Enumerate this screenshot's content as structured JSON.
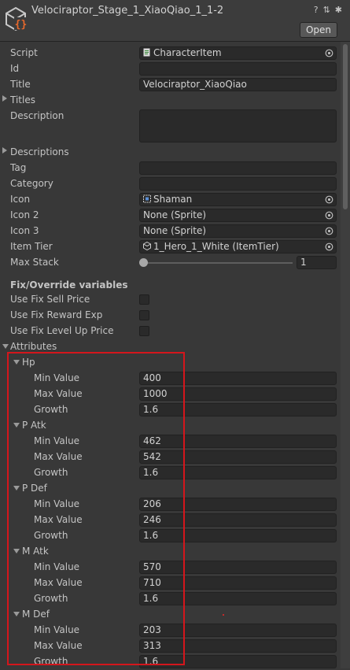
{
  "header": {
    "title": "Velociraptor_Stage_1_XiaoQiao_1_1-2",
    "open_label": "Open",
    "icons": [
      "help-icon",
      "preset-icon",
      "gear-icon"
    ],
    "help_glyph": "?",
    "preset_glyph": "⇅",
    "gear_glyph": "✱"
  },
  "fields": {
    "script": {
      "label": "Script",
      "value": "CharacterItem"
    },
    "id": {
      "label": "Id",
      "value": ""
    },
    "title": {
      "label": "Title",
      "value": "Velociraptor_XiaoQiao"
    },
    "titles": {
      "label": "Titles"
    },
    "description": {
      "label": "Description",
      "value": ""
    },
    "descriptions": {
      "label": "Descriptions"
    },
    "tag": {
      "label": "Tag",
      "value": ""
    },
    "category": {
      "label": "Category",
      "value": ""
    },
    "icon": {
      "label": "Icon",
      "value": "Shaman"
    },
    "icon2": {
      "label": "Icon 2",
      "value": "None (Sprite)"
    },
    "icon3": {
      "label": "Icon 3",
      "value": "None (Sprite)"
    },
    "item_tier": {
      "label": "Item Tier",
      "value": "1_Hero_1_White (ItemTier)"
    },
    "max_stack": {
      "label": "Max Stack",
      "value": "1"
    }
  },
  "overrides": {
    "heading": "Fix/Override variables",
    "items": [
      {
        "label": "Use Fix Sell Price",
        "checked": false
      },
      {
        "label": "Use Fix Reward Exp",
        "checked": false
      },
      {
        "label": "Use Fix Level Up Price",
        "checked": false
      }
    ]
  },
  "attributes": {
    "label": "Attributes",
    "min_label": "Min Value",
    "max_label": "Max Value",
    "growth_label": "Growth",
    "groups": [
      {
        "name": "Hp",
        "min": "400",
        "max": "1000",
        "growth": "1.6"
      },
      {
        "name": "P Atk",
        "min": "462",
        "max": "542",
        "growth": "1.6"
      },
      {
        "name": "P Def",
        "min": "206",
        "max": "246",
        "growth": "1.6"
      },
      {
        "name": "M Atk",
        "min": "570",
        "max": "710",
        "growth": "1.6"
      },
      {
        "name": "M Def",
        "min": "203",
        "max": "313",
        "growth": "1.6"
      }
    ]
  },
  "colors": {
    "highlight": "#d4161c",
    "panel": "#383838",
    "field": "#2a2a2a"
  }
}
